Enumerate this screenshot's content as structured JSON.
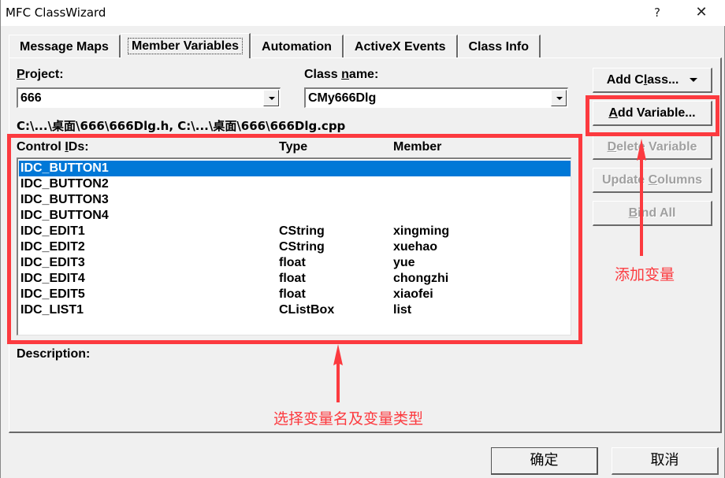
{
  "window": {
    "title": "MFC ClassWizard",
    "help_label": "?",
    "close_label": "✕"
  },
  "tabs": [
    {
      "label": "Message Maps",
      "active": false
    },
    {
      "label": "Member Variables",
      "active": true
    },
    {
      "label": "Automation",
      "active": false
    },
    {
      "label": "ActiveX Events",
      "active": false
    },
    {
      "label": "Class Info",
      "active": false
    }
  ],
  "project": {
    "label_accel": "P",
    "label_rest": "roject:",
    "value": "666"
  },
  "class_name": {
    "label_pre": "Class ",
    "label_accel": "n",
    "label_rest": "ame:",
    "value": "CMy666Dlg"
  },
  "file_path": "C:\\...\\桌面\\666\\666Dlg.h, C:\\...\\桌面\\666\\666Dlg.cpp",
  "list": {
    "header_id_pre": "Control ",
    "header_id_accel": "I",
    "header_id_rest": "Ds:",
    "header_type": "Type",
    "header_member": "Member",
    "rows": [
      {
        "id": "IDC_BUTTON1",
        "type": "",
        "member": "",
        "selected": true
      },
      {
        "id": "IDC_BUTTON2",
        "type": "",
        "member": ""
      },
      {
        "id": "IDC_BUTTON3",
        "type": "",
        "member": ""
      },
      {
        "id": "IDC_BUTTON4",
        "type": "",
        "member": ""
      },
      {
        "id": "IDC_EDIT1",
        "type": "CString",
        "member": "xingming"
      },
      {
        "id": "IDC_EDIT2",
        "type": "CString",
        "member": "xuehao"
      },
      {
        "id": "IDC_EDIT3",
        "type": "float",
        "member": "yue"
      },
      {
        "id": "IDC_EDIT4",
        "type": "float",
        "member": "chongzhi"
      },
      {
        "id": "IDC_EDIT5",
        "type": "float",
        "member": "xiaofei"
      },
      {
        "id": "IDC_LIST1",
        "type": "CListBox",
        "member": "list"
      }
    ]
  },
  "description_label": "Description:",
  "side_buttons": {
    "add_class": {
      "pre": "Add C",
      "accel": "l",
      "rest": "ass...",
      "enabled": true
    },
    "add_variable": {
      "pre": "",
      "accel": "A",
      "rest": "dd Variable...",
      "enabled": true
    },
    "delete_variable": {
      "pre": "",
      "accel": "D",
      "rest": "elete Variable",
      "enabled": false
    },
    "update_columns": {
      "pre": "Update ",
      "accel": "C",
      "rest": "olumns",
      "enabled": false
    },
    "bind_all": {
      "pre": "",
      "accel": "B",
      "rest": "ind All",
      "enabled": false
    }
  },
  "footer": {
    "ok_label": "确定",
    "cancel_label": "取消"
  },
  "annotations": {
    "add_variable_note": "添加变量",
    "list_note": "选择变量名及变量类型",
    "color": "#fc3a3f"
  },
  "colors": {
    "selection": "#0078d7",
    "face": "#f0f0f0"
  }
}
